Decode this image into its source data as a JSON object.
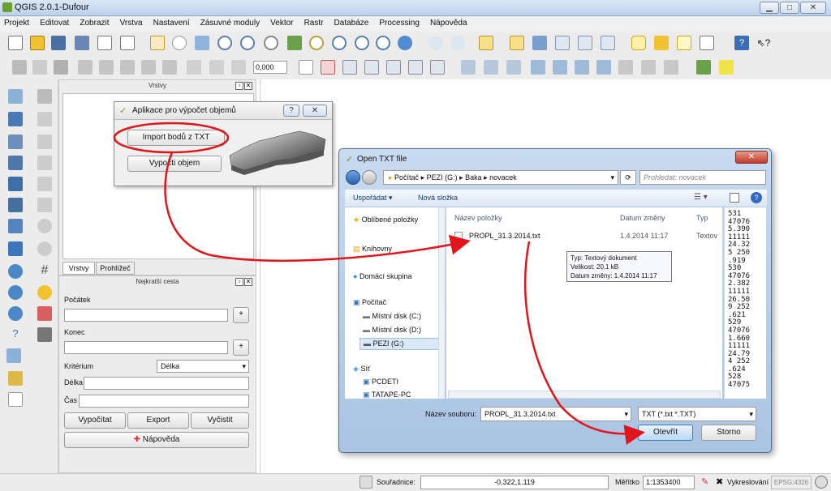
{
  "window": {
    "title": "QGIS 2.0.1-Dufour"
  },
  "menu": [
    "Projekt",
    "Editovat",
    "Zobrazit",
    "Vrstva",
    "Nastavení",
    "Zásuvné moduly",
    "Vektor",
    "Rastr",
    "Databáze",
    "Processing",
    "Nápověda"
  ],
  "toolbar": {
    "scale_value": "0,000"
  },
  "layers_panel": {
    "title": "Vrstvy",
    "tabs": [
      "Vrstvy",
      "Prohlížeč"
    ]
  },
  "route_panel": {
    "title": "Nejkratší cesta",
    "start_label": "Počátek",
    "end_label": "Konec",
    "criterion_label": "Kritérium",
    "criterion_value": "Délka",
    "length_label": "Délka",
    "time_label": "Čas",
    "calc_button": "Vypočítat",
    "export_button": "Export",
    "clear_button": "Vyčistit",
    "help_button": "Nápověda"
  },
  "app_dialog": {
    "title": "Aplikace pro výpočet objemů",
    "import_button": "Import bodů z TXT",
    "compute_button": "Vypočti objem"
  },
  "file_dialog": {
    "title": "Open TXT file",
    "breadcrumb": [
      "Počítač",
      "PEZI (G:)",
      "Baka",
      "novacek"
    ],
    "search_placeholder": "Prohledat: novacek",
    "organize": "Uspořádat ▾",
    "new_folder": "Nová složka",
    "nav": [
      {
        "label": "Oblíbené položky",
        "icon": "star-icon"
      },
      {
        "label": "Knihovny",
        "icon": "library-icon"
      },
      {
        "label": "Domácí skupina",
        "icon": "homegroup-icon"
      },
      {
        "label": "Počítač",
        "icon": "computer-icon"
      },
      {
        "label": "Místní disk (C:)",
        "icon": "disk-icon"
      },
      {
        "label": "Místní disk (D:)",
        "icon": "disk-icon"
      },
      {
        "label": "PEZI (G:)",
        "icon": "usb-drive-icon"
      },
      {
        "label": "Síť",
        "icon": "network-icon"
      },
      {
        "label": "PCDETI",
        "icon": "pc-icon"
      },
      {
        "label": "TATAPE-PC",
        "icon": "pc-icon"
      }
    ],
    "columns": [
      "Název položky",
      "Datum změny",
      "Typ"
    ],
    "file": {
      "name": "PROPL_31.3.2014.txt",
      "date": "1.4.2014 11:17",
      "type": "Textov"
    },
    "tooltip": [
      "Typ: Textový dokument",
      "Velikost: 20,1 kB",
      "Datum změny: 1.4.2014 11:17"
    ],
    "preview": [
      "531",
      "47076",
      "5.390",
      "11111",
      "24.32",
      "5 250",
      ".919",
      "530",
      "47076",
      "2.382",
      "11111",
      "26.50",
      "9 252",
      ".621",
      "529",
      "47076",
      "1.660",
      "11111",
      "24.79",
      "4 252",
      ".624",
      "528",
      "47075"
    ],
    "filename_label": "Název souboru:",
    "filename_value": "PROPL_31.3.2014.txt",
    "filter": "TXT (*.txt *.TXT)",
    "open_button": "Otevřít",
    "cancel_button": "Storno"
  },
  "status": {
    "coord_label": "Souřadnice:",
    "coord_value": "-0.322,1.119",
    "scale_label": "Měřítko",
    "scale_value": "1:1353400",
    "render_label": "Vykreslování",
    "epsg": "EPSG:4326"
  },
  "colors": {
    "annotation": "#e0161b",
    "accent": "#3c6fb0"
  }
}
